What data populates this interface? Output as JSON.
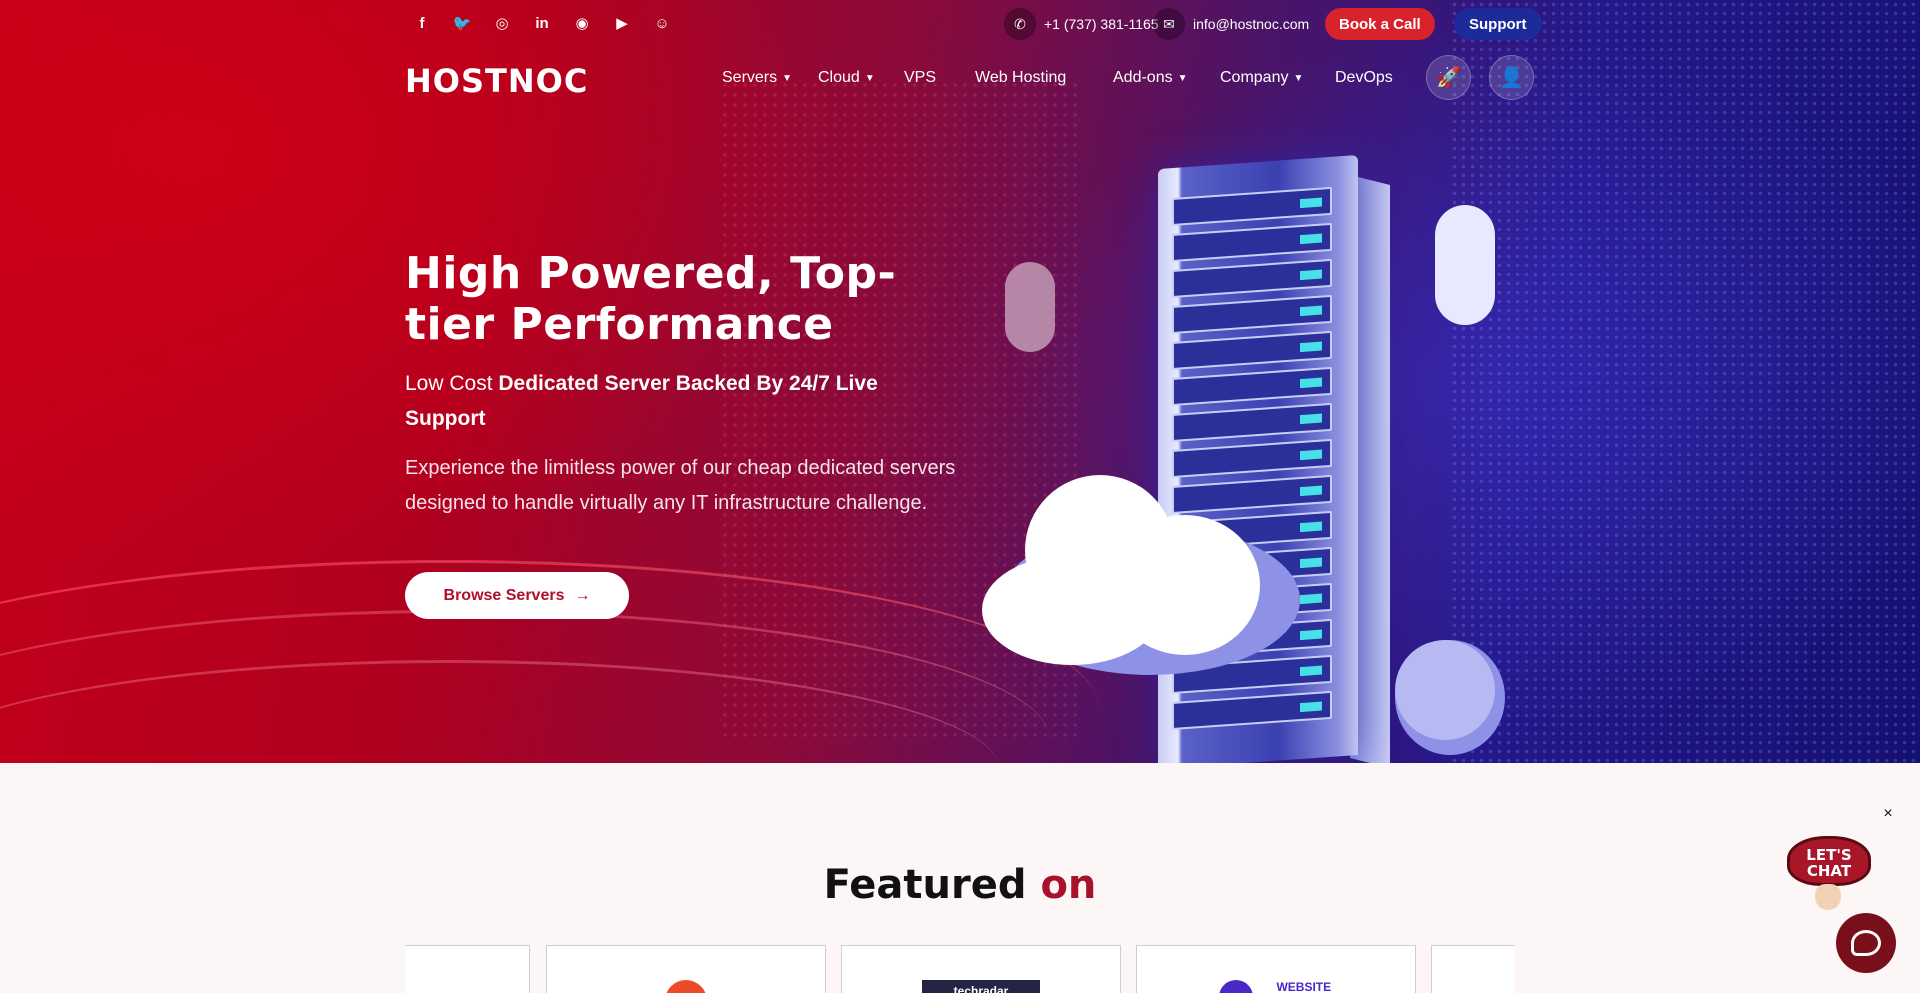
{
  "brand": {
    "logo": "HOSTNOC"
  },
  "topbar": {
    "social": [
      {
        "name": "facebook-icon",
        "glyph": "f"
      },
      {
        "name": "twitter-icon",
        "glyph": "🐦"
      },
      {
        "name": "instagram-icon",
        "glyph": "◎"
      },
      {
        "name": "linkedin-icon",
        "glyph": "in"
      },
      {
        "name": "discord-icon",
        "glyph": "◉"
      },
      {
        "name": "youtube-icon",
        "glyph": "▶"
      },
      {
        "name": "reddit-icon",
        "glyph": "☺"
      }
    ],
    "phone": "+1 (737) 381-1165",
    "email": "info@hostnoc.com",
    "book_call": "Book a Call",
    "support": "Support"
  },
  "nav": {
    "servers": "Servers",
    "cloud": "Cloud",
    "vps": "VPS",
    "web_hosting": "Web Hosting",
    "addons": "Add-ons",
    "company": "Company",
    "devops": "DevOps"
  },
  "hero": {
    "title": "High Powered, Top-tier Performance",
    "sub_light": "Low Cost ",
    "sub_bold": "Dedicated Server Backed By 24/7 Live Support",
    "description": "Experience the limitless power of our cheap dedicated servers designed to handle virtually any IT infrastructure challenge.",
    "cta": "Browse Servers"
  },
  "featured": {
    "title_main": "Featured ",
    "title_accent": "on",
    "cards": [
      "",
      "",
      "techradar",
      "WEBSITE",
      ""
    ]
  },
  "chat": {
    "close": "×",
    "badge_line1": "LET'S",
    "badge_line2": "CHAT"
  },
  "colors": {
    "accent_red": "#d8222c",
    "support_blue": "#1d2a9a",
    "featured_accent": "#a8112a"
  }
}
